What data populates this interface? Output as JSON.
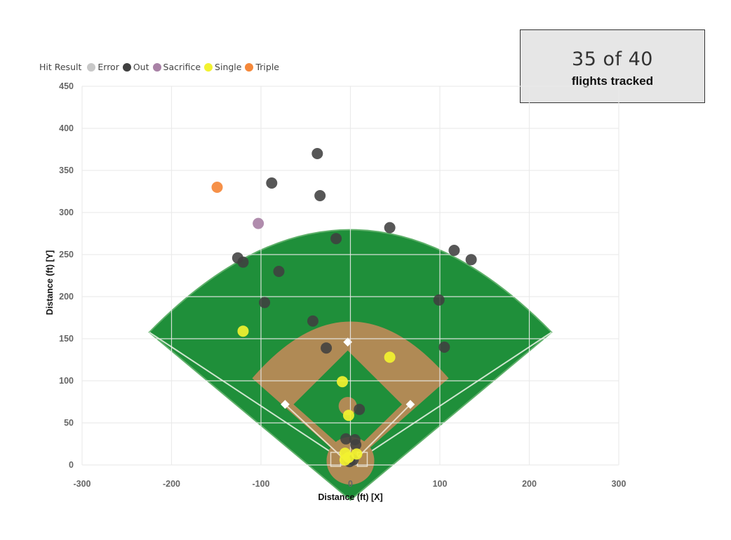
{
  "kpi": {
    "value": "35 of 40",
    "label": "flights tracked"
  },
  "legend": {
    "title": "Hit Result",
    "items": [
      {
        "name": "Error",
        "color": "#c8c8c8"
      },
      {
        "name": "Out",
        "color": "#404040"
      },
      {
        "name": "Sacrifice",
        "color": "#a982a6"
      },
      {
        "name": "Single",
        "color": "#f2f230"
      },
      {
        "name": "Triple",
        "color": "#f5883a"
      }
    ]
  },
  "chart_data": {
    "type": "scatter",
    "xlabel": "Distance (ft) [X]",
    "ylabel": "Distance (ft) [Y]",
    "xlim": [
      -300,
      300
    ],
    "ylim": [
      0,
      450
    ],
    "xticks": [
      -300,
      -200,
      -100,
      0,
      100,
      200,
      300
    ],
    "yticks": [
      0,
      50,
      100,
      150,
      200,
      250,
      300,
      350,
      400,
      450
    ],
    "grid": true,
    "legend_position": "top-left",
    "background": "baseball field",
    "series": [
      {
        "name": "Error",
        "color": "#c8c8c8",
        "points": []
      },
      {
        "name": "Out",
        "color": "#404040",
        "points": [
          [
            -37,
            370
          ],
          [
            -88,
            335
          ],
          [
            -34,
            320
          ],
          [
            44,
            282
          ],
          [
            -16,
            269
          ],
          [
            -126,
            246
          ],
          [
            -120,
            241
          ],
          [
            116,
            255
          ],
          [
            135,
            244
          ],
          [
            -80,
            230
          ],
          [
            -96,
            193
          ],
          [
            99,
            196
          ],
          [
            -42,
            171
          ],
          [
            -27,
            139
          ],
          [
            105,
            140
          ],
          [
            10,
            66
          ],
          [
            -5,
            31
          ],
          [
            5,
            30
          ],
          [
            6,
            24
          ],
          [
            3,
            6
          ],
          [
            -1,
            4
          ]
        ]
      },
      {
        "name": "Sacrifice",
        "color": "#a982a6",
        "points": [
          [
            -103,
            287
          ]
        ]
      },
      {
        "name": "Single",
        "color": "#f2f230",
        "points": [
          [
            -120,
            159
          ],
          [
            44,
            128
          ],
          [
            -9,
            99
          ],
          [
            -2,
            59
          ],
          [
            -6,
            14
          ],
          [
            7,
            13
          ],
          [
            -6,
            6
          ],
          [
            -2,
            9
          ]
        ]
      },
      {
        "name": "Triple",
        "color": "#f5883a",
        "points": [
          [
            -149,
            330
          ]
        ]
      }
    ]
  }
}
